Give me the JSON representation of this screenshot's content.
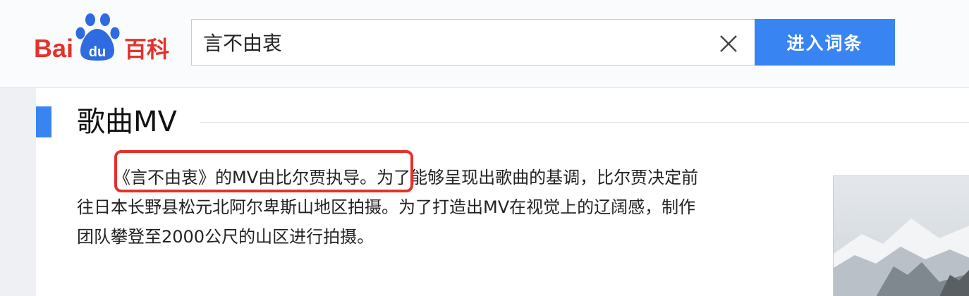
{
  "header": {
    "logo_text": "Bai du 百科",
    "search": {
      "value": "言不由衷",
      "placeholder": ""
    },
    "search_button_label": "进入词条"
  },
  "section": {
    "title": "歌曲MV",
    "paragraph_lines": [
      "《言不由衷》的MV由比尔贾执导。为了能够呈现出歌曲的基调，比尔贾决定前",
      "往日本长野县松元北阿尔卑斯山地区拍摄。为了打造出MV在视觉上的辽阔感，制作",
      "团队攀登至2000公尺的山区进行拍摄。"
    ]
  },
  "colors": {
    "brand_red": "#e4322b",
    "brand_blue": "#3884f2",
    "section_bar": "#3884f2",
    "highlight_border": "#e4322b"
  },
  "icons": {
    "clear": "close-icon"
  }
}
